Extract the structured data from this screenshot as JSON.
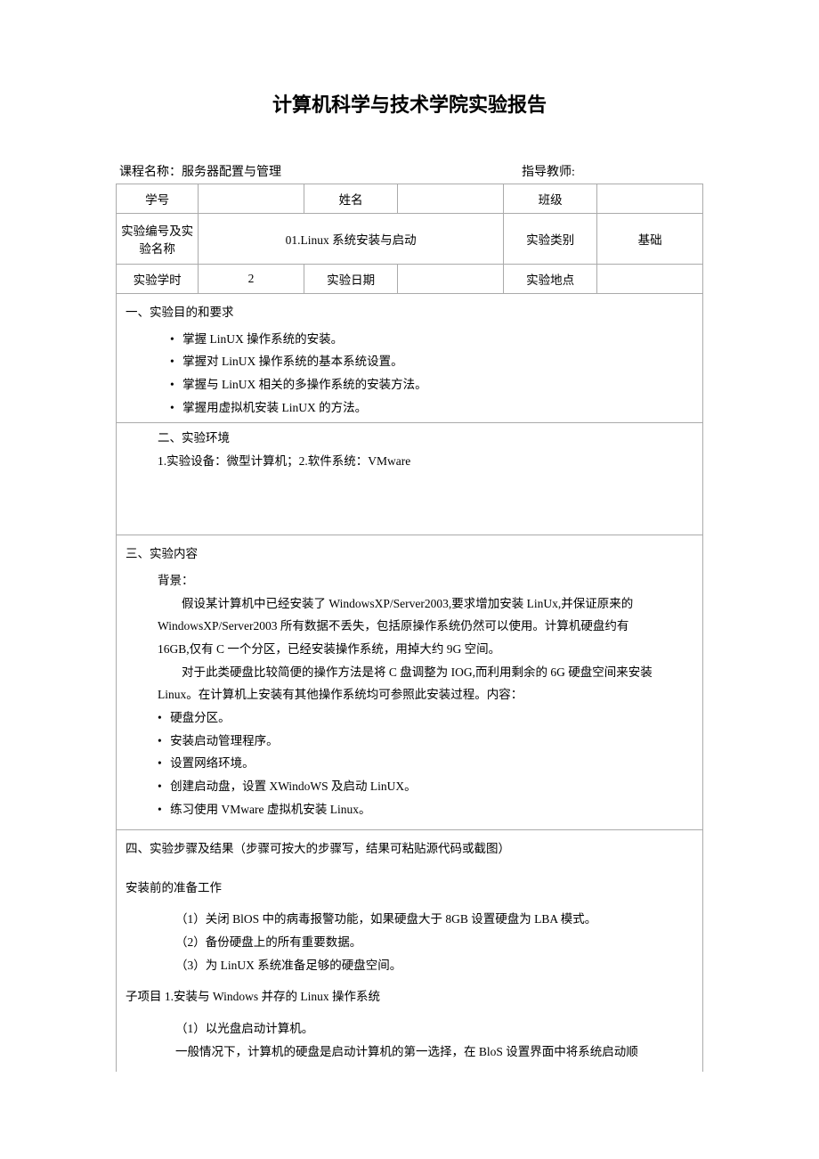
{
  "title": "计算机科学与技术学院实验报告",
  "meta": {
    "courseLabel": "课程名称：",
    "courseValue": "服务器配置与管理",
    "teacherLabel": "指导教师:"
  },
  "row1": {
    "c1": "学号",
    "c2": "",
    "c3": "姓名",
    "c4": "",
    "c5": "班级",
    "c6": ""
  },
  "row2": {
    "c1": "实验编号及实验名称",
    "c2": "01.Linux 系统安装与启动",
    "c3": "实验类别",
    "c4": "基础"
  },
  "row3": {
    "c1": "实验学时",
    "c2": "2",
    "c3": "实验日期",
    "c4": "",
    "c5": "实验地点",
    "c6": ""
  },
  "section1": {
    "head": "一、实验目的和要求",
    "items": [
      "掌握 LinUX 操作系统的安装。",
      "掌握对 LinUX 操作系统的基本系统设置。",
      "掌握与 LinUX 相关的多操作系统的安装方法。",
      "掌握用虚拟机安装 LinUX 的方法。"
    ]
  },
  "section2": {
    "head": "二、实验环境",
    "line": "1.实验设备：微型计算机；2.软件系统：VMware"
  },
  "section3": {
    "head": "三、实验内容",
    "bgLabel": "背景：",
    "p1": "假设某计算机中已经安装了 WindowsXP/Server2003,要求增加安装 LinUx,并保证原来的",
    "p2": "WindowsXP/Server2003 所有数据不丢失，包括原操作系统仍然可以使用。计算机硬盘约有",
    "p3": "16GB,仅有 C 一个分区，已经安装操作系统，用掉大约 9G 空间。",
    "p4": "对于此类硬盘比较简便的操作方法是将 C 盘调整为 IOG,而利用剩余的 6G 硬盘空间来安装",
    "p5": "Linux。在计算机上安装有其他操作系统均可参照此安装过程。内容：",
    "items": [
      "硬盘分区。",
      "安装启动管理程序。",
      "设置网络环境。",
      "创建启动盘，设置 XWindoWS 及启动 LinUX。",
      "练习使用 VMware 虚拟机安装 Linux。"
    ]
  },
  "section4": {
    "head": "四、实验步骤及结果（步骤可按大的步骤写，结果可粘贴源代码或截图）",
    "prepHead": "安装前的准备工作",
    "prep": [
      "（1）关闭 BlOS 中的病毒报警功能，如果硬盘大于 8GB 设置硬盘为 LBA 模式。",
      "（2）备份硬盘上的所有重要数据。",
      "（3）为 LinUX 系统准备足够的硬盘空间。"
    ],
    "sub1Head": "子项目 1.安装与 Windows 并存的 Linux 操作系统",
    "sub1a": "（1）以光盘启动计算机。",
    "sub1b": "一般情况下，计算机的硬盘是启动计算机的第一选择，在 BloS 设置界面中将系统启动顺"
  }
}
